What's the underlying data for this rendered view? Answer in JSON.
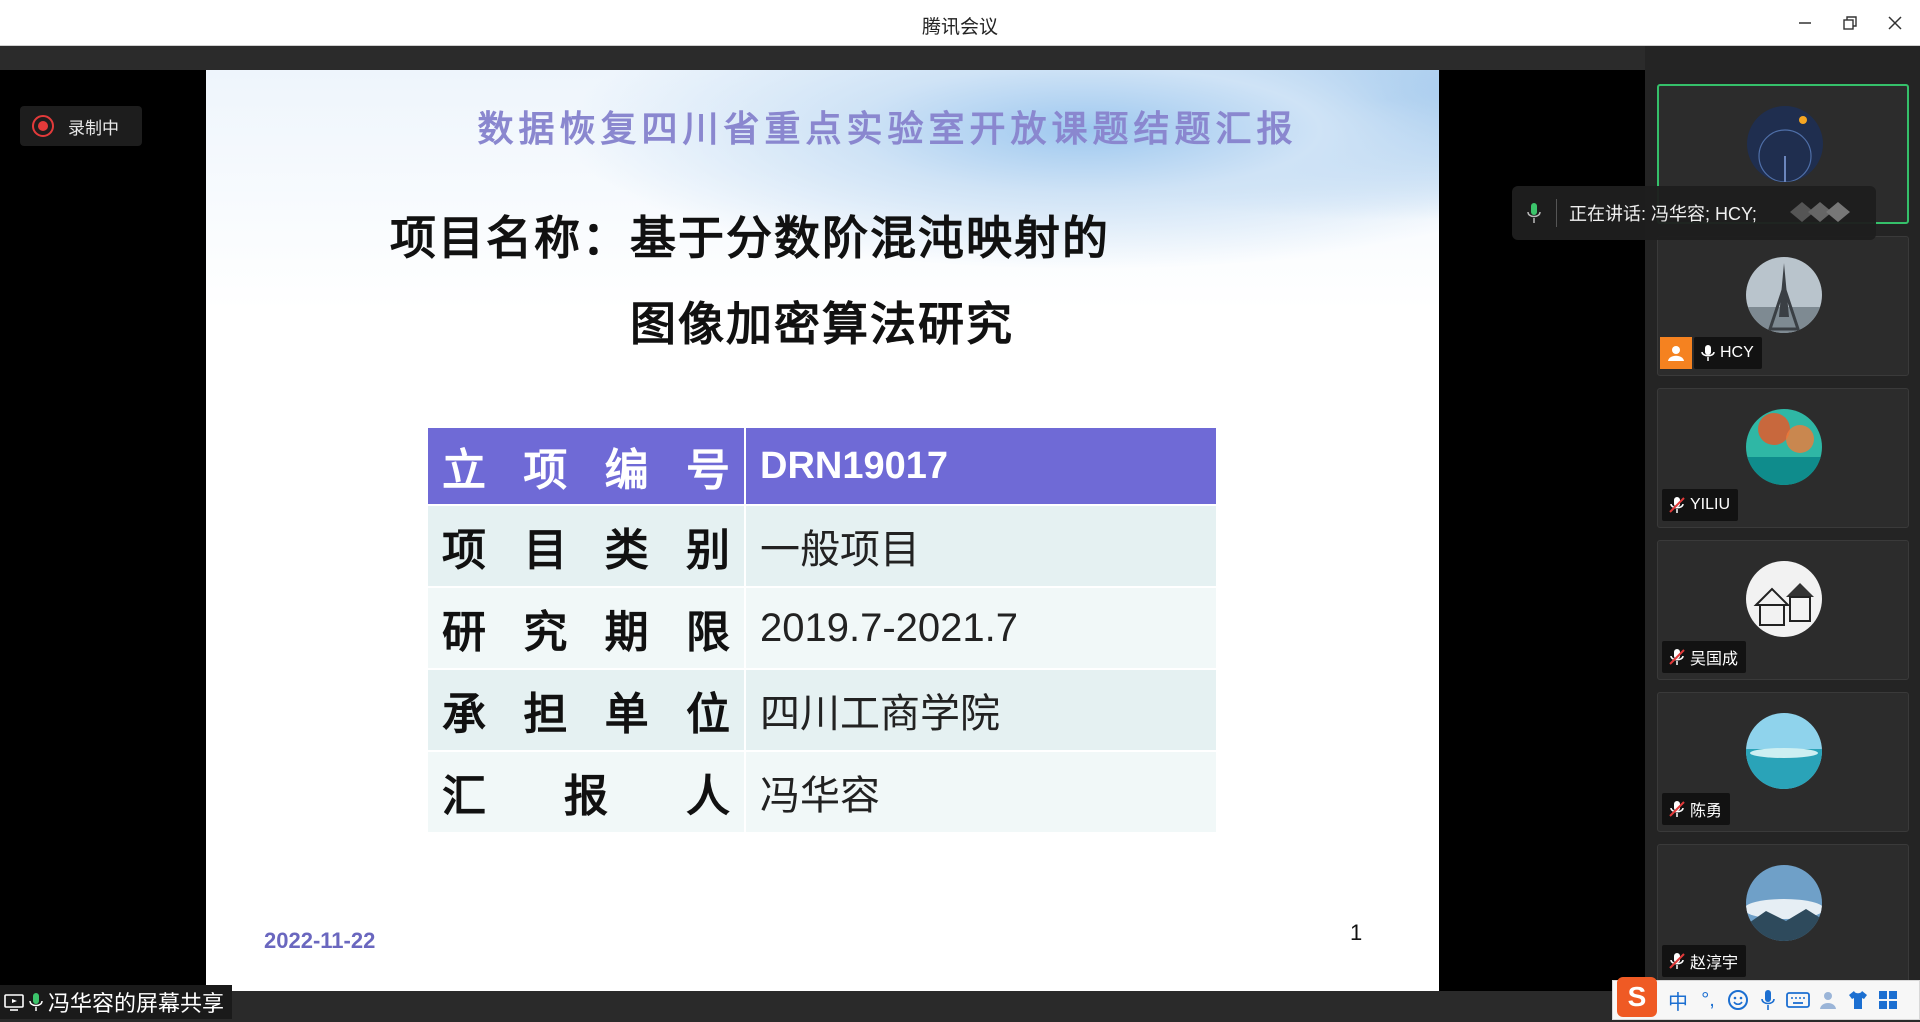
{
  "window": {
    "title": "腾讯会议"
  },
  "recording": {
    "label": "录制中"
  },
  "slide": {
    "header": "数据恢复四川省重点实验室开放课题结题汇报",
    "project_title_line1": "项目名称：基于分数阶混沌映射的",
    "project_title_line2": "图像加密算法研究",
    "table": [
      {
        "key": [
          "立",
          "项",
          "编",
          "号"
        ],
        "value": "DRN19017"
      },
      {
        "key": [
          "项",
          "目",
          "类",
          "别"
        ],
        "value": "一般项目"
      },
      {
        "key": [
          "研",
          "究",
          "期",
          "限"
        ],
        "value": "2019.7-2021.7"
      },
      {
        "key": [
          "承",
          "担",
          "单",
          "位"
        ],
        "value": "四川工商学院"
      },
      {
        "key": [
          "汇",
          "报",
          "人"
        ],
        "value": "冯华容"
      }
    ],
    "date": "2022-11-22",
    "page_number": "1"
  },
  "speaking": {
    "text": "正在讲话: 冯华容; HCY;"
  },
  "participants": [
    {
      "name": "",
      "muted": false,
      "active": true,
      "avatar": "ferris-wheel-night"
    },
    {
      "name": "HCY",
      "muted": false,
      "active": false,
      "host": true,
      "avatar": "eiffel-tower"
    },
    {
      "name": "YILIU",
      "muted": true,
      "active": false,
      "avatar": "ocean-coral"
    },
    {
      "name": "吴国成",
      "muted": true,
      "active": false,
      "avatar": "sketch-houses"
    },
    {
      "name": "陈勇",
      "muted": true,
      "active": false,
      "avatar": "tropical-lagoon"
    },
    {
      "name": "赵淳宇",
      "muted": true,
      "active": false,
      "avatar": "mountain-clouds"
    }
  ],
  "screen_share": {
    "label": "冯华容的屏幕共享"
  },
  "ime": {
    "mode": "中",
    "punct": "°,"
  },
  "colors": {
    "slide_header": "#8a87cf",
    "table_head": "#6f6ad6",
    "active_border": "#35c06a",
    "record_red": "#e23a3a",
    "ime_logo": "#ef5a24"
  }
}
